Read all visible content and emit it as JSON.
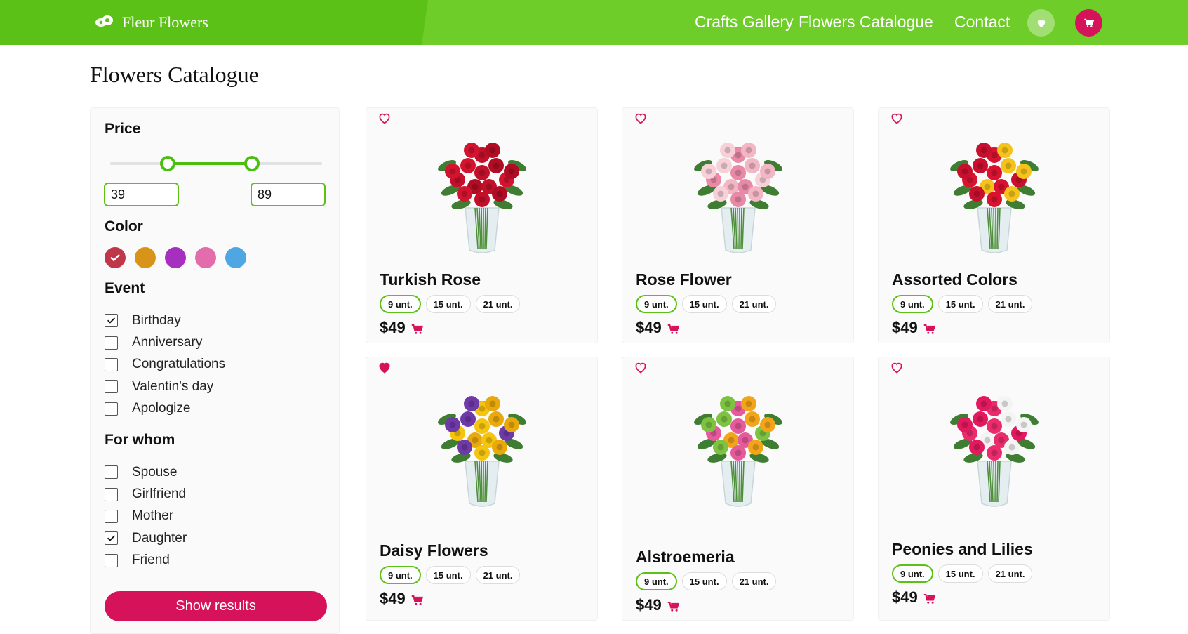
{
  "header": {
    "brand": "Fleur Flowers",
    "nav": [
      {
        "label": "Crafts Gallery"
      },
      {
        "label": "Flowers Catalogue"
      },
      {
        "label": "Contact"
      }
    ],
    "favorites_icon": "heart-icon",
    "cart_icon": "cart-icon"
  },
  "page": {
    "title": "Flowers Catalogue"
  },
  "filters": {
    "price": {
      "heading": "Price",
      "min_value": "39",
      "max_value": "89",
      "range_start_fraction": 0.27,
      "range_end_fraction": 0.67
    },
    "color": {
      "heading": "Color",
      "swatches": [
        {
          "color": "#c0374a",
          "selected": true
        },
        {
          "color": "#d89418",
          "selected": false
        },
        {
          "color": "#a62fc0",
          "selected": false
        },
        {
          "color": "#e36cac",
          "selected": false
        },
        {
          "color": "#4ea7e2",
          "selected": false
        }
      ]
    },
    "event": {
      "heading": "Event",
      "options": [
        {
          "label": "Birthday",
          "checked": true
        },
        {
          "label": "Anniversary",
          "checked": false
        },
        {
          "label": "Congratulations",
          "checked": false
        },
        {
          "label": "Valentin's day",
          "checked": false
        },
        {
          "label": "Apologize",
          "checked": false
        }
      ]
    },
    "for_whom": {
      "heading": "For whom",
      "options": [
        {
          "label": "Spouse",
          "checked": false
        },
        {
          "label": "Girlfriend",
          "checked": false
        },
        {
          "label": "Mother",
          "checked": false
        },
        {
          "label": "Daughter",
          "checked": true
        },
        {
          "label": "Friend",
          "checked": false
        }
      ]
    },
    "submit_label": "Show results"
  },
  "products": [
    {
      "name": "Turkish Rose",
      "favorite": false,
      "quantities": [
        "9 unt.",
        "15 unt.",
        "21 unt."
      ],
      "selected_qty": 0,
      "price": "$49",
      "flowers": [
        "#c3102a",
        "#d4142f",
        "#b00d24"
      ]
    },
    {
      "name": "Rose Flower",
      "favorite": false,
      "quantities": [
        "9 unt.",
        "15 unt.",
        "21 unt."
      ],
      "selected_qty": 0,
      "price": "$49",
      "flowers": [
        "#f2b6c4",
        "#e88aa6",
        "#f7d0d8"
      ]
    },
    {
      "name": "Assorted Colors",
      "favorite": false,
      "quantities": [
        "9 unt.",
        "15 unt.",
        "21 unt."
      ],
      "selected_qty": 0,
      "price": "$49",
      "flowers": [
        "#c8102e",
        "#f6c21c",
        "#d7132f"
      ]
    },
    {
      "name": "Daisy Flowers",
      "favorite": true,
      "quantities": [
        "9 unt.",
        "15 unt.",
        "21 unt."
      ],
      "selected_qty": 0,
      "price": "$49",
      "flowers": [
        "#f5c40e",
        "#6d3aa8",
        "#e9a90c"
      ]
    },
    {
      "name": "Alstroemeria",
      "favorite": false,
      "quantities": [
        "9 unt.",
        "15 unt.",
        "21 unt."
      ],
      "selected_qty": 0,
      "price": "$49",
      "flowers": [
        "#f3a51a",
        "#e45a9b",
        "#7dc241"
      ]
    },
    {
      "name": "Peonies and Lilies",
      "favorite": false,
      "quantities": [
        "9 unt.",
        "15 unt.",
        "21 unt."
      ],
      "selected_qty": 0,
      "price": "$49",
      "flowers": [
        "#e3195f",
        "#f4f4f4",
        "#ea2c6c"
      ]
    }
  ],
  "colors": {
    "header_green": "#5cc116",
    "accent_pink": "#d6135a",
    "slider_green": "#4bbf10"
  }
}
